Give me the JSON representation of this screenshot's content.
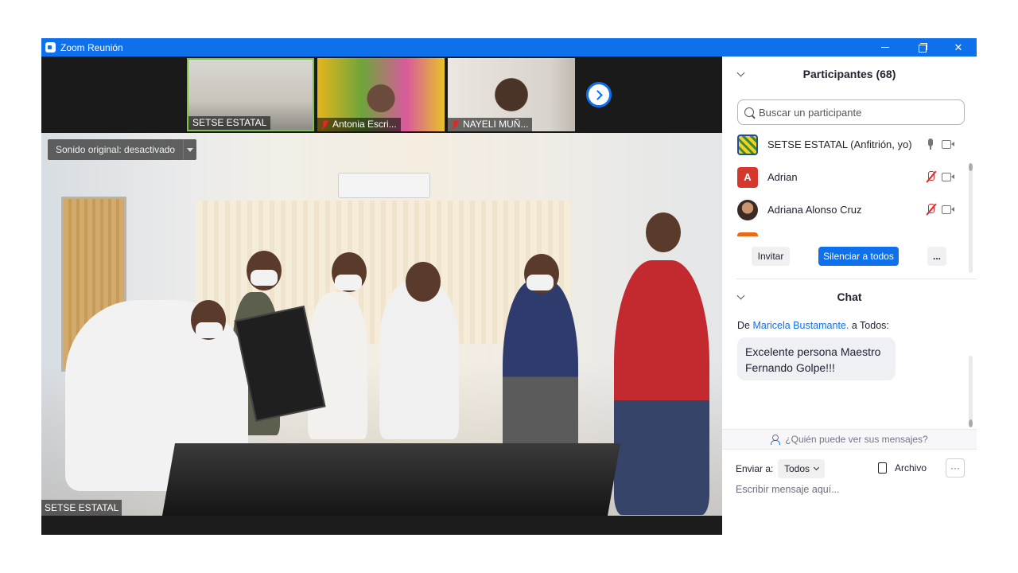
{
  "window": {
    "title": "Zoom Reunión"
  },
  "video": {
    "thumbnails": [
      {
        "name": "SETSE ESTATAL",
        "muted": false
      },
      {
        "name": "Antonia Escri...",
        "muted": true
      },
      {
        "name": "NAYELI MUÑ...",
        "muted": true
      }
    ],
    "audio_setting": "Sonido original: desactivado",
    "main_speaker": "SETSE ESTATAL"
  },
  "participants": {
    "header": "Participantes (68)",
    "search_placeholder": "Buscar un participante",
    "list": [
      {
        "name": "SETSE ESTATAL (Anfitrión, yo)",
        "avatar_letter": "",
        "mic": "on"
      },
      {
        "name": "Adrian",
        "avatar_letter": "A",
        "mic": "muted"
      },
      {
        "name": "Adriana Alonso Cruz",
        "avatar_letter": "",
        "mic": "muted"
      }
    ],
    "invite_label": "Invitar",
    "mute_all_label": "Silenciar a todos",
    "more_label": "..."
  },
  "chat": {
    "header": "Chat",
    "from_prefix": "De",
    "sender": "Maricela Bustamante.",
    "to_text": "a Todos:",
    "message": "Excelente persona Maestro Fernando Golpe!!!",
    "privacy_text": "¿Quién puede ver sus mensajes?",
    "send_to_label": "Enviar a:",
    "send_to_value": "Todos",
    "file_label": "Archivo",
    "more_label": "···",
    "input_placeholder": "Escribir mensaje aquí..."
  },
  "colors": {
    "accent": "#0e71eb",
    "muted_red": "#e02828"
  }
}
